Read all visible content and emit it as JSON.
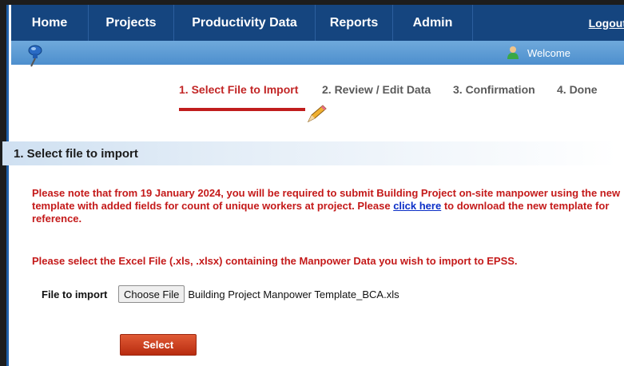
{
  "nav": {
    "home": "Home",
    "projects": "Projects",
    "productivity": "Productivity Data",
    "reports": "Reports",
    "admin": "Admin",
    "logout": "Logout"
  },
  "subbar": {
    "welcome": "Welcome"
  },
  "steps": [
    {
      "label": "1. Select File to Import",
      "active": true
    },
    {
      "label": "2. Review / Edit Data",
      "active": false
    },
    {
      "label": "3. Confirmation",
      "active": false
    },
    {
      "label": "4. Done",
      "active": false
    }
  ],
  "section": {
    "title": "1. Select file to import"
  },
  "notice1": {
    "before": "Please note that from 19 January 2024, you will be required to submit Building Project on-site manpower using the new template with added fields for count of unique workers at project. Please ",
    "link": "click here",
    "after": " to download the new template for reference."
  },
  "notice2": "Please select the Excel File (.xls, .xlsx) containing the Manpower Data you wish to import to EPSS.",
  "file": {
    "label": "File to import",
    "button": "Choose File",
    "filename": "Building Project Manpower Template_BCA.xls"
  },
  "select_button": "Select",
  "colors": {
    "nav_bg": "#15457f",
    "subbar_bg": "#5a9ad4",
    "accent_red": "#c22626",
    "link_blue": "#0b2fc7"
  }
}
